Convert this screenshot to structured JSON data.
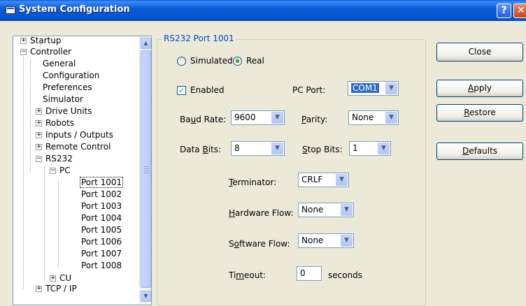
{
  "window": {
    "title": "System Configuration",
    "help": "?",
    "close": "✕"
  },
  "tree": {
    "items": [
      {
        "label": "Startup"
      },
      {
        "label": "Controller"
      },
      {
        "label": "General"
      },
      {
        "label": "Configuration"
      },
      {
        "label": "Preferences"
      },
      {
        "label": "Simulator"
      },
      {
        "label": "Drive Units"
      },
      {
        "label": "Robots"
      },
      {
        "label": "Inputs / Outputs"
      },
      {
        "label": "Remote Control"
      },
      {
        "label": "RS232"
      },
      {
        "label": "PC"
      },
      {
        "label": "Port 1001"
      },
      {
        "label": "Port 1002"
      },
      {
        "label": "Port 1003"
      },
      {
        "label": "Port 1004"
      },
      {
        "label": "Port 1005"
      },
      {
        "label": "Port 1006"
      },
      {
        "label": "Port 1007"
      },
      {
        "label": "Port 1008"
      },
      {
        "label": "CU"
      },
      {
        "label": "TCP / IP"
      }
    ]
  },
  "group": {
    "title": "RS232 Port 1001",
    "mode_simulated": "Simulated",
    "mode_real": "Real",
    "enabled": "Enabled",
    "pc_port_label": "PC Port:",
    "pc_port_value": "COM1",
    "baud_label": "Baud Rate:",
    "baud_value": "9600",
    "parity_label": "Parity:",
    "parity_value": "None",
    "databits_label": "Data Bits:",
    "databits_value": "8",
    "stopbits_label": "Stop Bits:",
    "stopbits_value": "1",
    "terminator_label": "Terminator:",
    "terminator_value": "CRLF",
    "hwflow_label": "Hardware Flow:",
    "hwflow_value": "None",
    "swflow_label": "Software Flow:",
    "swflow_value": "None",
    "timeout_label": "Timeout:",
    "timeout_value": "0",
    "timeout_unit": "seconds"
  },
  "buttons": {
    "close": "Close",
    "apply": "Apply",
    "restore": "Restore",
    "defaults": "Defaults"
  }
}
